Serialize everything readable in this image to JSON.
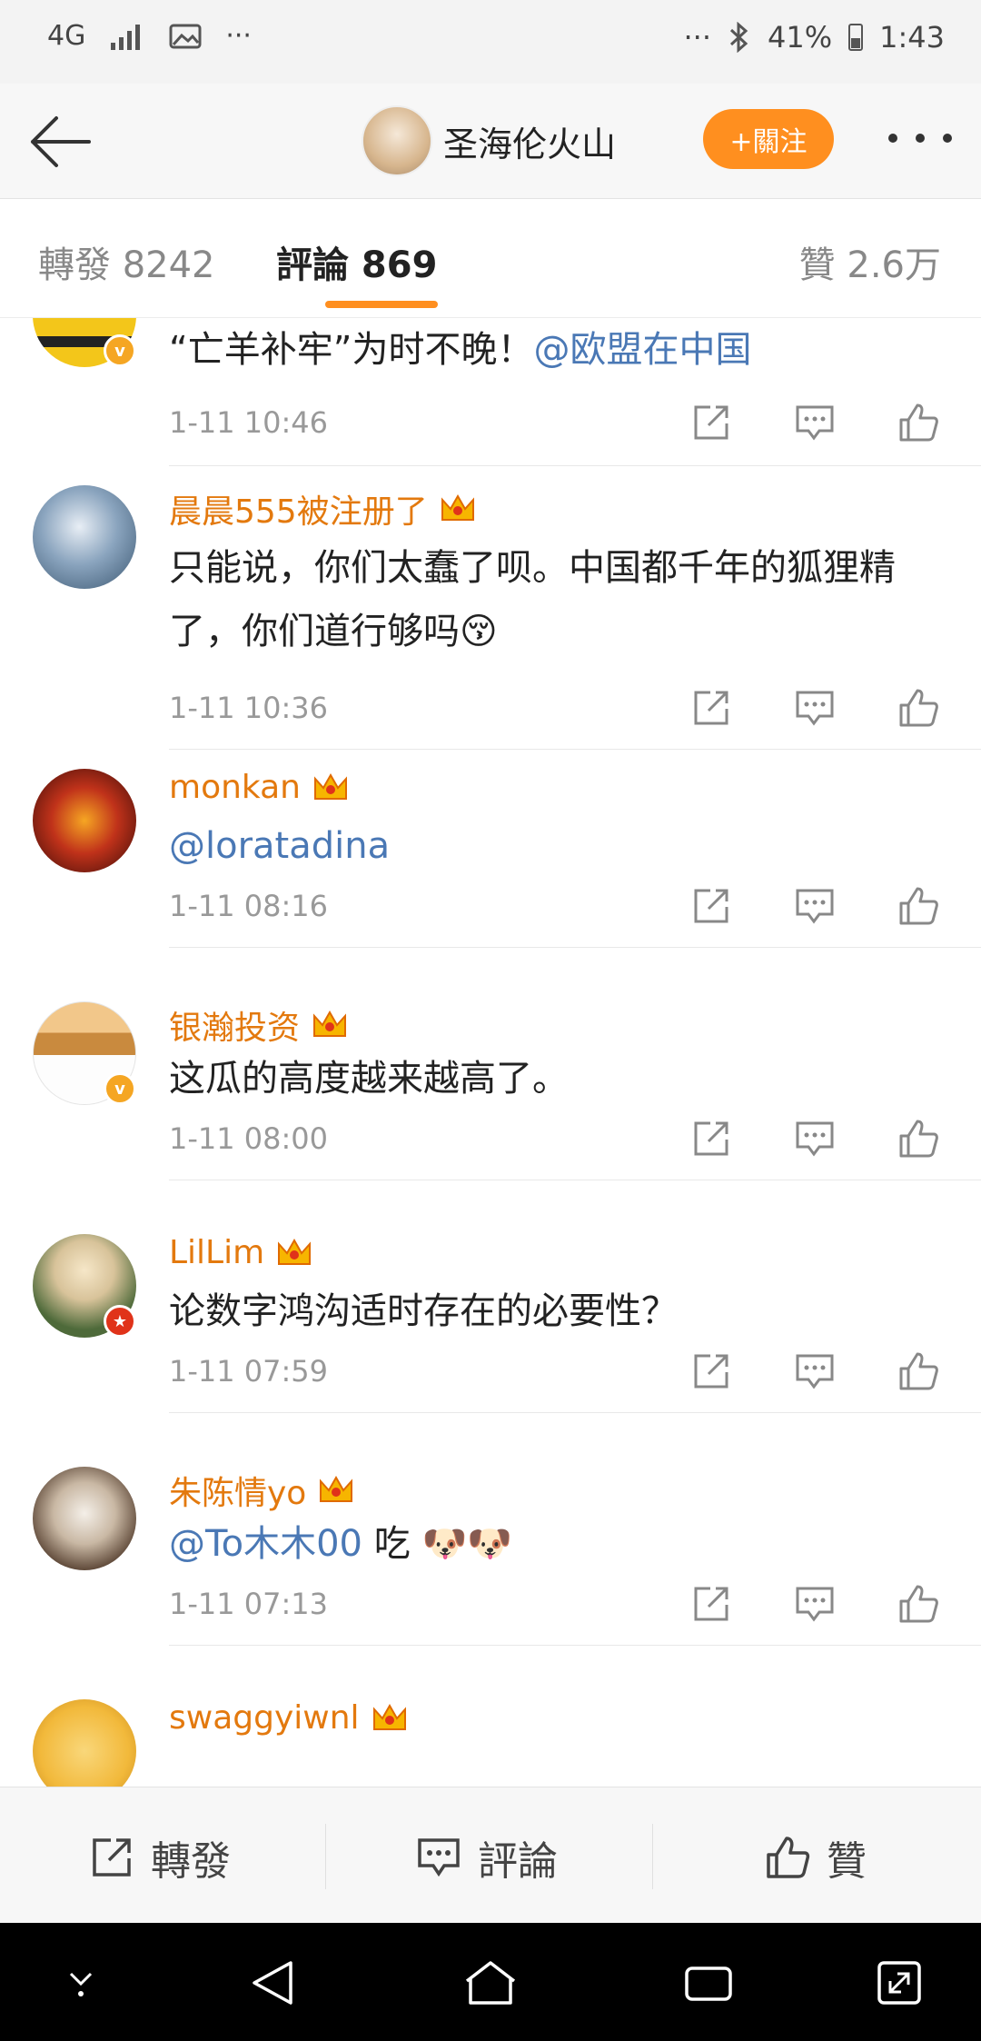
{
  "status_bar": {
    "network": "4G",
    "dots": "···",
    "battery": "41%",
    "time": "1:43"
  },
  "header": {
    "title": "圣海伦火山",
    "follow_label": "+關注"
  },
  "tabs": [
    {
      "label": "轉發 8242"
    },
    {
      "label": "評論 869"
    },
    {
      "label": "贊 2.6万"
    }
  ],
  "comments": [
    {
      "text": "“亡羊补牢”为时不晚！",
      "mention": "@欧盟在中国",
      "time": "1-11 10:46"
    },
    {
      "user": "晨晨555被注册了",
      "text": "只能说，你们太蠢了呗。中国都千年的狐狸精了，你们道行够吗😚",
      "time": "1-11 10:36"
    },
    {
      "user": "monkan",
      "mention": "@loratadina",
      "time": "1-11 08:16"
    },
    {
      "user": "银瀚投资",
      "text": "这瓜的高度越来越高了。",
      "time": "1-11 08:00"
    },
    {
      "user": "LilLim",
      "text": "论数字鸿沟适时存在的必要性？",
      "time": "1-11 07:59"
    },
    {
      "user": "朱陈情yo",
      "mention": "@To木木00",
      "text": " 吃 🐶🐶",
      "time": "1-11 07:13"
    },
    {
      "user": "swaggyiwnl"
    }
  ],
  "bottom_bar": {
    "repost": "轉發",
    "comment": "評論",
    "like": "贊"
  },
  "colors": {
    "accent": "#ff8f1f",
    "username": "#e3790e",
    "mention": "#4a78b5"
  }
}
